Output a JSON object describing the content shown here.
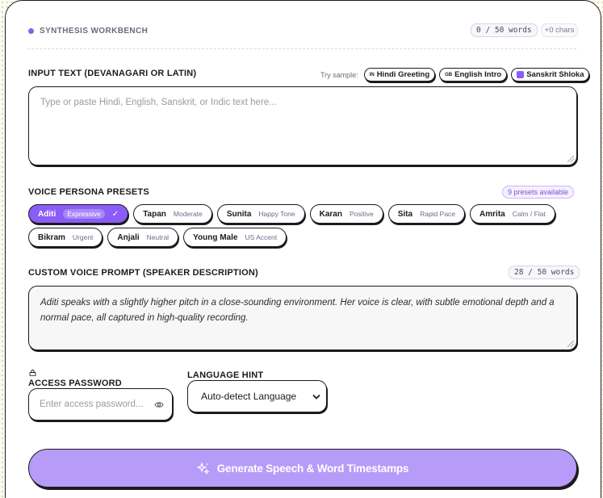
{
  "header": {
    "brand": "SYNTHESIS WORKBENCH",
    "word_count": "0 / 50 words",
    "char_count": "+0 chars"
  },
  "input": {
    "label": "INPUT TEXT (DEVANAGARI OR LATIN)",
    "try_label": "Try sample:",
    "placeholder": "Type or paste Hindi, English, Sanskrit, or Indic text here...",
    "samples": [
      {
        "icon": "IN",
        "label": "Hindi Greeting"
      },
      {
        "icon": "GB",
        "label": "English Intro"
      },
      {
        "icon": "square",
        "label": "Sanskrit Shloka"
      }
    ]
  },
  "presets": {
    "label": "VOICE PERSONA PRESETS",
    "count": "9 presets available",
    "items": [
      {
        "name": "Aditi",
        "tone": "Expressive",
        "active": true
      },
      {
        "name": "Tapan",
        "tone": "Moderate"
      },
      {
        "name": "Sunita",
        "tone": "Happy Tone"
      },
      {
        "name": "Karan",
        "tone": "Positive"
      },
      {
        "name": "Sita",
        "tone": "Rapid Pace"
      },
      {
        "name": "Amrita",
        "tone": "Calm / Flat"
      },
      {
        "name": "Bikram",
        "tone": "Urgent"
      },
      {
        "name": "Anjali",
        "tone": "Neutral"
      },
      {
        "name": "Young Male",
        "tone": "US Accent"
      }
    ]
  },
  "prompt": {
    "label": "CUSTOM VOICE PROMPT (SPEAKER DESCRIPTION)",
    "word_count": "28 / 50 words",
    "value": "Aditi speaks with a slightly higher pitch in a close-sounding environment. Her voice is clear, with subtle emotional depth and a normal pace, all captured in high-quality recording."
  },
  "password": {
    "label": "ACCESS PASSWORD",
    "placeholder": "Enter access password..."
  },
  "language": {
    "label": "LANGUAGE HINT",
    "selected": "Auto-detect Language"
  },
  "generate": {
    "label": "Generate Speech & Word Timestamps"
  },
  "colors": {
    "accent": "#8b5cf6",
    "button": "#b79bf8"
  }
}
